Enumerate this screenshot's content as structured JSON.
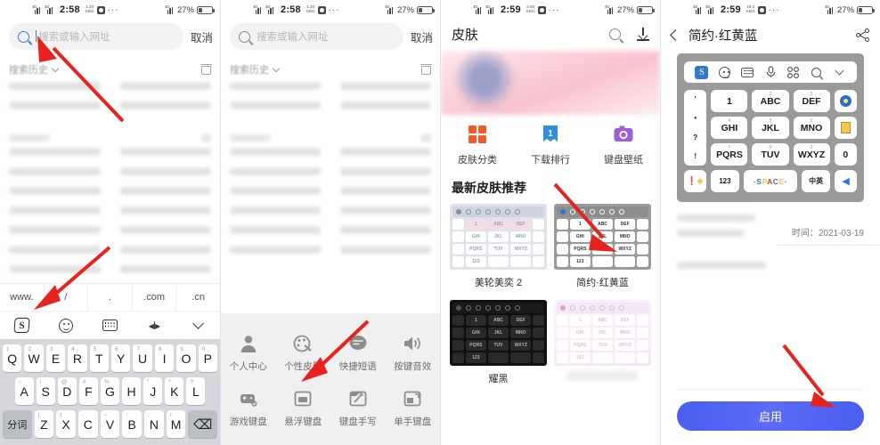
{
  "statusbar": {
    "time1": "2:58",
    "time2": "2:59",
    "battery": "27%",
    "dots": "···",
    "net": "4G"
  },
  "panel1": {
    "search": {
      "placeholder": "搜索或输入网址",
      "cancel": "取消",
      "icon": "search-icon"
    },
    "history": {
      "title": "搜索历史",
      "clear_icon": "trash-icon"
    },
    "urlbar": [
      "www.",
      "/",
      ".",
      ".com",
      ".cn"
    ],
    "toolbar_icons": [
      "sogou-logo-icon",
      "emoji-icon",
      "keyboard-icon",
      "cursor-move-icon",
      "chevron-down-icon"
    ],
    "keyboard": {
      "row1": [
        {
          "k": "Q",
          "n": "1"
        },
        {
          "k": "W",
          "n": "2"
        },
        {
          "k": "E",
          "n": "3"
        },
        {
          "k": "R",
          "n": "4"
        },
        {
          "k": "T",
          "n": "5"
        },
        {
          "k": "Y",
          "n": "6"
        },
        {
          "k": "U",
          "n": "7"
        },
        {
          "k": "I",
          "n": "8"
        },
        {
          "k": "O",
          "n": "9"
        },
        {
          "k": "P",
          "n": "0"
        }
      ],
      "row2": [
        {
          "k": "A",
          "n": "~"
        },
        {
          "k": "S",
          "n": "!"
        },
        {
          "k": "D",
          "n": "@"
        },
        {
          "k": "F",
          "n": "#"
        },
        {
          "k": "G",
          "n": "%"
        },
        {
          "k": "H",
          "n": "´"
        },
        {
          "k": "J",
          "n": "\""
        },
        {
          "k": "K",
          "n": "*"
        },
        {
          "k": "L",
          "n": "?"
        }
      ],
      "row3_left": "分词",
      "row3": [
        {
          "k": "Z",
          "n": "("
        },
        {
          "k": "X",
          "n": ")"
        },
        {
          "k": "C",
          "n": "-"
        },
        {
          "k": "V",
          "n": "~"
        },
        {
          "k": "B",
          "n": ":"
        },
        {
          "k": "N",
          "n": ";"
        },
        {
          "k": "M",
          "n": "/"
        }
      ],
      "backspace": "⌫"
    }
  },
  "panel2": {
    "search": {
      "placeholder": "搜索或输入网址",
      "cancel": "取消"
    },
    "history": {
      "title": "搜索历史"
    },
    "urlbar": [
      "www.",
      "/",
      ".",
      ".com",
      ".cn"
    ],
    "menu": [
      {
        "label": "个人中心",
        "icon": "person-icon"
      },
      {
        "label": "个性皮肤",
        "icon": "palette-icon"
      },
      {
        "label": "快捷短语",
        "icon": "chat-bubble-icon"
      },
      {
        "label": "按键音效",
        "icon": "speaker-icon"
      },
      {
        "label": "游戏键盘",
        "icon": "gamepad-icon"
      },
      {
        "label": "悬浮键盘",
        "icon": "floating-keyboard-icon"
      },
      {
        "label": "键盘手写",
        "icon": "handwriting-icon"
      },
      {
        "label": "单手键盘",
        "icon": "one-hand-keyboard-icon"
      }
    ]
  },
  "panel3": {
    "title": "皮肤",
    "header_icons": [
      "search-icon",
      "download-icon"
    ],
    "categories": [
      {
        "label": "皮肤分类",
        "icon": "grid-squares-icon",
        "color": "#f05a28"
      },
      {
        "label": "下载排行",
        "icon": "ranking-banner-icon",
        "color": "#2f8de0"
      },
      {
        "label": "键盘壁纸",
        "icon": "camera-icon",
        "color": "#a05fd8"
      }
    ],
    "section_title": "最新皮肤推荐",
    "skins": [
      {
        "name": "美轮美奕 2",
        "theme": "pastel"
      },
      {
        "name": "简约·红黄蓝",
        "theme": "gray"
      },
      {
        "name": "耀黑",
        "theme": "black"
      },
      {
        "name": "",
        "theme": "pink"
      }
    ]
  },
  "panel4": {
    "title": "简约·红黄蓝",
    "back_icon": "back-chevron-icon",
    "share_icon": "share-icon",
    "time_label": "时间：2021-03-19",
    "enable_button": "启用",
    "preview": {
      "toolbar_icons": [
        "sogou-logo-icon",
        "emoji-icon",
        "keyboard-icon",
        "mic-icon",
        "apps-grid-icon",
        "search-icon",
        "chevron-down-icon"
      ],
      "keys": [
        [
          {
            "k": "'",
            "n": ""
          },
          {
            "k": "1",
            "n": ""
          },
          {
            "k": "ABC",
            "n": "2"
          },
          {
            "k": "DEF",
            "n": "3"
          },
          {
            "k": "◉",
            "n": ""
          }
        ],
        [
          {
            "k": "•",
            "n": ""
          },
          {
            "k": "GHI",
            "n": "4"
          },
          {
            "k": "JKL",
            "n": "5"
          },
          {
            "k": "MNO",
            "n": "6"
          },
          {
            "k": "▤",
            "n": ""
          }
        ],
        [
          {
            "k": "?",
            "n": ""
          },
          {
            "k": "PQRS",
            "n": "7"
          },
          {
            "k": "TUV",
            "n": "8"
          },
          {
            "k": "WXYZ",
            "n": "9"
          },
          {
            "k": "0",
            "n": ""
          }
        ],
        [
          {
            "k": "!",
            "n": ""
          },
          {
            "k": "",
            "n": ""
          },
          {
            "k": "",
            "n": ""
          },
          {
            "k": "",
            "n": ""
          },
          {
            "k": "",
            "n": ""
          }
        ]
      ],
      "bottom_row": [
        "•◆",
        "123",
        "SPACE",
        "中英",
        "◀"
      ]
    }
  },
  "colors": {
    "accent_blue": "#4a5ef0",
    "sogou_blue": "#2f76d9",
    "orange": "#f05a28",
    "purple": "#a05fd8",
    "arrow_red": "#e8231d"
  }
}
